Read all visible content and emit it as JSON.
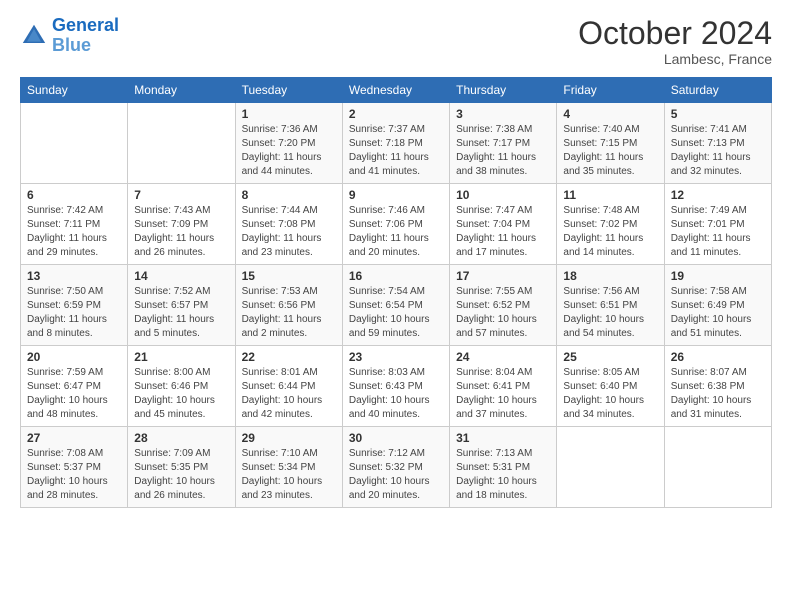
{
  "header": {
    "logo_line1": "General",
    "logo_line2": "Blue",
    "month": "October 2024",
    "location": "Lambesc, France"
  },
  "days_of_week": [
    "Sunday",
    "Monday",
    "Tuesday",
    "Wednesday",
    "Thursday",
    "Friday",
    "Saturday"
  ],
  "weeks": [
    [
      {
        "day": "",
        "sunrise": "",
        "sunset": "",
        "daylight": ""
      },
      {
        "day": "",
        "sunrise": "",
        "sunset": "",
        "daylight": ""
      },
      {
        "day": "1",
        "sunrise": "Sunrise: 7:36 AM",
        "sunset": "Sunset: 7:20 PM",
        "daylight": "Daylight: 11 hours and 44 minutes."
      },
      {
        "day": "2",
        "sunrise": "Sunrise: 7:37 AM",
        "sunset": "Sunset: 7:18 PM",
        "daylight": "Daylight: 11 hours and 41 minutes."
      },
      {
        "day": "3",
        "sunrise": "Sunrise: 7:38 AM",
        "sunset": "Sunset: 7:17 PM",
        "daylight": "Daylight: 11 hours and 38 minutes."
      },
      {
        "day": "4",
        "sunrise": "Sunrise: 7:40 AM",
        "sunset": "Sunset: 7:15 PM",
        "daylight": "Daylight: 11 hours and 35 minutes."
      },
      {
        "day": "5",
        "sunrise": "Sunrise: 7:41 AM",
        "sunset": "Sunset: 7:13 PM",
        "daylight": "Daylight: 11 hours and 32 minutes."
      }
    ],
    [
      {
        "day": "6",
        "sunrise": "Sunrise: 7:42 AM",
        "sunset": "Sunset: 7:11 PM",
        "daylight": "Daylight: 11 hours and 29 minutes."
      },
      {
        "day": "7",
        "sunrise": "Sunrise: 7:43 AM",
        "sunset": "Sunset: 7:09 PM",
        "daylight": "Daylight: 11 hours and 26 minutes."
      },
      {
        "day": "8",
        "sunrise": "Sunrise: 7:44 AM",
        "sunset": "Sunset: 7:08 PM",
        "daylight": "Daylight: 11 hours and 23 minutes."
      },
      {
        "day": "9",
        "sunrise": "Sunrise: 7:46 AM",
        "sunset": "Sunset: 7:06 PM",
        "daylight": "Daylight: 11 hours and 20 minutes."
      },
      {
        "day": "10",
        "sunrise": "Sunrise: 7:47 AM",
        "sunset": "Sunset: 7:04 PM",
        "daylight": "Daylight: 11 hours and 17 minutes."
      },
      {
        "day": "11",
        "sunrise": "Sunrise: 7:48 AM",
        "sunset": "Sunset: 7:02 PM",
        "daylight": "Daylight: 11 hours and 14 minutes."
      },
      {
        "day": "12",
        "sunrise": "Sunrise: 7:49 AM",
        "sunset": "Sunset: 7:01 PM",
        "daylight": "Daylight: 11 hours and 11 minutes."
      }
    ],
    [
      {
        "day": "13",
        "sunrise": "Sunrise: 7:50 AM",
        "sunset": "Sunset: 6:59 PM",
        "daylight": "Daylight: 11 hours and 8 minutes."
      },
      {
        "day": "14",
        "sunrise": "Sunrise: 7:52 AM",
        "sunset": "Sunset: 6:57 PM",
        "daylight": "Daylight: 11 hours and 5 minutes."
      },
      {
        "day": "15",
        "sunrise": "Sunrise: 7:53 AM",
        "sunset": "Sunset: 6:56 PM",
        "daylight": "Daylight: 11 hours and 2 minutes."
      },
      {
        "day": "16",
        "sunrise": "Sunrise: 7:54 AM",
        "sunset": "Sunset: 6:54 PM",
        "daylight": "Daylight: 10 hours and 59 minutes."
      },
      {
        "day": "17",
        "sunrise": "Sunrise: 7:55 AM",
        "sunset": "Sunset: 6:52 PM",
        "daylight": "Daylight: 10 hours and 57 minutes."
      },
      {
        "day": "18",
        "sunrise": "Sunrise: 7:56 AM",
        "sunset": "Sunset: 6:51 PM",
        "daylight": "Daylight: 10 hours and 54 minutes."
      },
      {
        "day": "19",
        "sunrise": "Sunrise: 7:58 AM",
        "sunset": "Sunset: 6:49 PM",
        "daylight": "Daylight: 10 hours and 51 minutes."
      }
    ],
    [
      {
        "day": "20",
        "sunrise": "Sunrise: 7:59 AM",
        "sunset": "Sunset: 6:47 PM",
        "daylight": "Daylight: 10 hours and 48 minutes."
      },
      {
        "day": "21",
        "sunrise": "Sunrise: 8:00 AM",
        "sunset": "Sunset: 6:46 PM",
        "daylight": "Daylight: 10 hours and 45 minutes."
      },
      {
        "day": "22",
        "sunrise": "Sunrise: 8:01 AM",
        "sunset": "Sunset: 6:44 PM",
        "daylight": "Daylight: 10 hours and 42 minutes."
      },
      {
        "day": "23",
        "sunrise": "Sunrise: 8:03 AM",
        "sunset": "Sunset: 6:43 PM",
        "daylight": "Daylight: 10 hours and 40 minutes."
      },
      {
        "day": "24",
        "sunrise": "Sunrise: 8:04 AM",
        "sunset": "Sunset: 6:41 PM",
        "daylight": "Daylight: 10 hours and 37 minutes."
      },
      {
        "day": "25",
        "sunrise": "Sunrise: 8:05 AM",
        "sunset": "Sunset: 6:40 PM",
        "daylight": "Daylight: 10 hours and 34 minutes."
      },
      {
        "day": "26",
        "sunrise": "Sunrise: 8:07 AM",
        "sunset": "Sunset: 6:38 PM",
        "daylight": "Daylight: 10 hours and 31 minutes."
      }
    ],
    [
      {
        "day": "27",
        "sunrise": "Sunrise: 7:08 AM",
        "sunset": "Sunset: 5:37 PM",
        "daylight": "Daylight: 10 hours and 28 minutes."
      },
      {
        "day": "28",
        "sunrise": "Sunrise: 7:09 AM",
        "sunset": "Sunset: 5:35 PM",
        "daylight": "Daylight: 10 hours and 26 minutes."
      },
      {
        "day": "29",
        "sunrise": "Sunrise: 7:10 AM",
        "sunset": "Sunset: 5:34 PM",
        "daylight": "Daylight: 10 hours and 23 minutes."
      },
      {
        "day": "30",
        "sunrise": "Sunrise: 7:12 AM",
        "sunset": "Sunset: 5:32 PM",
        "daylight": "Daylight: 10 hours and 20 minutes."
      },
      {
        "day": "31",
        "sunrise": "Sunrise: 7:13 AM",
        "sunset": "Sunset: 5:31 PM",
        "daylight": "Daylight: 10 hours and 18 minutes."
      },
      {
        "day": "",
        "sunrise": "",
        "sunset": "",
        "daylight": ""
      },
      {
        "day": "",
        "sunrise": "",
        "sunset": "",
        "daylight": ""
      }
    ]
  ]
}
